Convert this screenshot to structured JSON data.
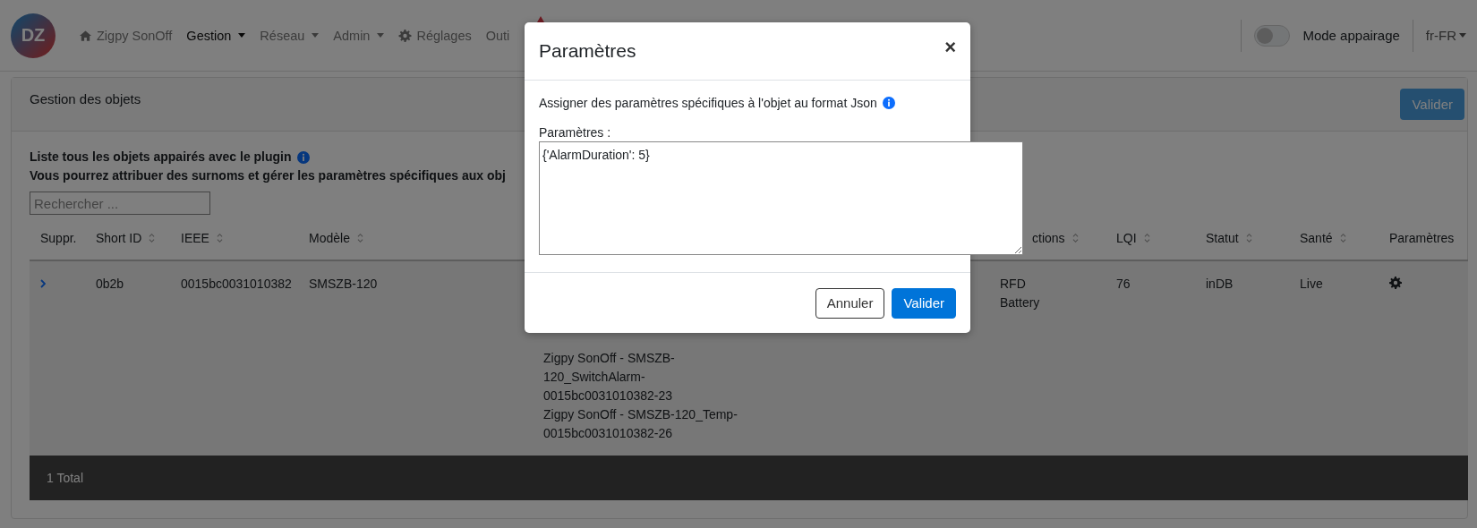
{
  "navbar": {
    "logo": "DZ",
    "items": [
      {
        "label": "Zigpy SonOff",
        "kind": "home",
        "selected": false
      },
      {
        "label": "Gestion",
        "kind": "dropdown",
        "selected": true
      },
      {
        "label": "Réseau",
        "kind": "dropdown",
        "selected": false
      },
      {
        "label": "Admin",
        "kind": "dropdown",
        "selected": false
      },
      {
        "label": "Réglages",
        "kind": "settings",
        "selected": false
      },
      {
        "label": "Outi",
        "kind": "link",
        "selected": false
      }
    ],
    "pairing_mode": {
      "label": "Mode appairage",
      "on": false
    },
    "language": "fr-FR"
  },
  "card": {
    "title": "Gestion des objets",
    "button": "Valider",
    "intro": [
      "Liste tous les objets appairés avec le plugin",
      "Vous pourrez attribuer des surnoms et gérer les paramètres spécifiques aux obj"
    ],
    "search": {
      "placeholder": "Rechercher ..."
    },
    "table": {
      "columns": [
        {
          "label": "Suppr."
        },
        {
          "label": "Short ID",
          "sortable": true
        },
        {
          "label": "IEEE",
          "sortable": true
        },
        {
          "label": "Modèle",
          "sortable": true
        },
        {
          "label": "ctions",
          "sortable": true
        },
        {
          "label": "LQI",
          "sortable": true
        },
        {
          "label": "Statut",
          "sortable": true
        },
        {
          "label": "Santé",
          "sortable": true
        },
        {
          "label": "Paramètres"
        }
      ],
      "rows": [
        {
          "short_id": "0b2b",
          "ieee": "0015bc0031010382",
          "model": "SMSZB-120",
          "domoticz": [
            "Zigpy SonOff - SMSZB-120_SwitchAlarm-0015bc0031010382-23",
            "Zigpy SonOff - SMSZB-120_Temp-0015bc0031010382-26"
          ],
          "capabilities": [
            "RFD",
            "Battery"
          ],
          "lqi": "76",
          "status": "inDB",
          "health": "Live"
        }
      ]
    },
    "footer": "1 Total"
  },
  "modal": {
    "title": "Paramètres",
    "close": "×",
    "description": "Assigner des paramètres spécifiques à l'objet au format Json",
    "field_label": "Paramètres :",
    "value": "{'AlarmDuration': 5}",
    "buttons": [
      {
        "label": "Annuler",
        "kind": "secondary"
      },
      {
        "label": "Valider",
        "kind": "primary"
      }
    ]
  }
}
